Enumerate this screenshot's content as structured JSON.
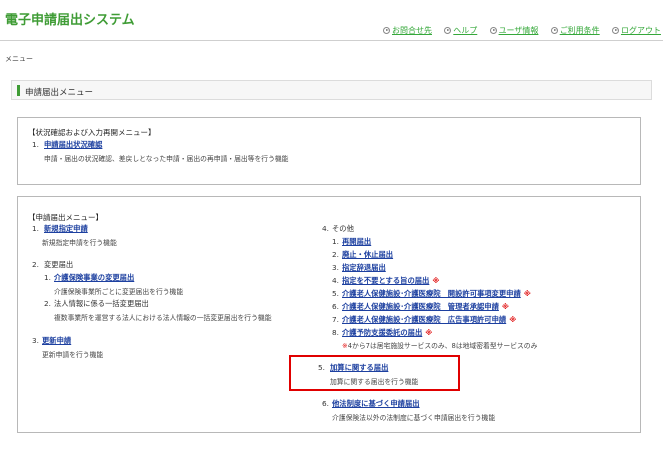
{
  "header": {
    "app_title": "電子申請届出システム",
    "nav": [
      "お問合せ先",
      "ヘルプ",
      "ユーザ情報",
      "ご利用条件",
      "ログアウト"
    ]
  },
  "breadcrumb": "メニュー",
  "section_title": "申請届出メニュー",
  "status_box": {
    "title": "【状況確認および入力再開メニュー】",
    "item_num": "1.",
    "item_link": "申請届出状況確認",
    "item_desc": "申請・届出の状況確認、差戻しとなった申請・届出の再申請・届出等を行う機能"
  },
  "menu_box": {
    "title": "【申請届出メニュー】",
    "left": {
      "n1": "1.",
      "l1": "新規指定申請",
      "d1": "新規指定申請を行う機能",
      "n2": "2.",
      "l2": "変更届出",
      "n2_1": "1.",
      "l2_1": "介護保険事業の変更届出",
      "d2_1": "介護保険事業所ごとに変更届出を行う機能",
      "n2_2": "2.",
      "l2_2": "法人情報に係る一括変更届出",
      "d2_2": "複数事業所を運営する法人における法人情報の一括変更届出を行う機能",
      "n3": "3.",
      "l3": "更新申請",
      "d3": "更新申請を行う機能"
    },
    "right": {
      "n4": "4.",
      "l4": "その他",
      "subs": [
        {
          "num": "1.",
          "label": "再開届出",
          "mark": ""
        },
        {
          "num": "2.",
          "label": "廃止・休止届出",
          "mark": ""
        },
        {
          "num": "3.",
          "label": "指定辞退届出",
          "mark": ""
        },
        {
          "num": "4.",
          "label": "指定を不要とする旨の届出",
          "mark": "※"
        },
        {
          "num": "5.",
          "label": "介護老人保健施設･介護医療院　開設許可事項変更申請",
          "mark": "※"
        },
        {
          "num": "6.",
          "label": "介護老人保健施設･介護医療院　管理者承認申請",
          "mark": "※"
        },
        {
          "num": "7.",
          "label": "介護老人保健施設･介護医療院　広告事項許可申請",
          "mark": "※"
        },
        {
          "num": "8.",
          "label": "介護予防支援委託の届出",
          "mark": "※"
        }
      ],
      "note_mark": "※",
      "note_text": "4から7は居宅施設サービスのみ、8は地域密着型サービスのみ",
      "n5": "5.",
      "l5": "加算に関する届出",
      "d5": "加算に関する届出を行う機能",
      "n6": "6.",
      "l6": "他法制度に基づく申請届出",
      "d6": "介護保険法以外の法制度に基づく申請届出を行う機能"
    }
  }
}
